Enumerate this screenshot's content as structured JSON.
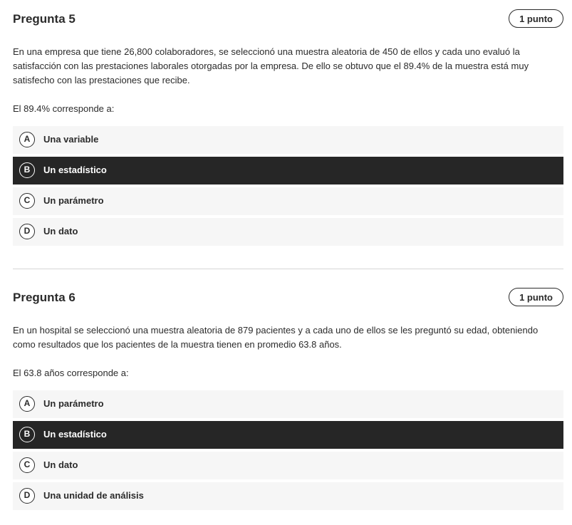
{
  "questions": [
    {
      "title": "Pregunta 5",
      "points": "1 punto",
      "text": "En una empresa que tiene 26,800 colaboradores, se seleccionó una muestra aleatoria de 450 de ellos y cada uno evaluó la satisfacción con las prestaciones laborales otorgadas por la empresa. De ello se obtuvo que el 89.4% de la muestra está muy satisfecho con las prestaciones que recibe.",
      "prompt": "El 89.4% corresponde a:",
      "selected": "B",
      "options": [
        {
          "letter": "A",
          "label": "Una variable"
        },
        {
          "letter": "B",
          "label": "Un estadístico"
        },
        {
          "letter": "C",
          "label": "Un parámetro"
        },
        {
          "letter": "D",
          "label": "Un dato"
        }
      ]
    },
    {
      "title": "Pregunta 6",
      "points": "1 punto",
      "text": "En un hospital se seleccionó una muestra aleatoria de 879 pacientes y a cada uno de ellos se les preguntó su edad, obteniendo como resultados que los pacientes de la muestra tienen en promedio 63.8 años.",
      "prompt": "El 63.8 años corresponde a:",
      "selected": "B",
      "options": [
        {
          "letter": "A",
          "label": "Un parámetro"
        },
        {
          "letter": "B",
          "label": "Un estadístico"
        },
        {
          "letter": "C",
          "label": "Un dato"
        },
        {
          "letter": "D",
          "label": "Una unidad de análisis"
        }
      ]
    }
  ]
}
